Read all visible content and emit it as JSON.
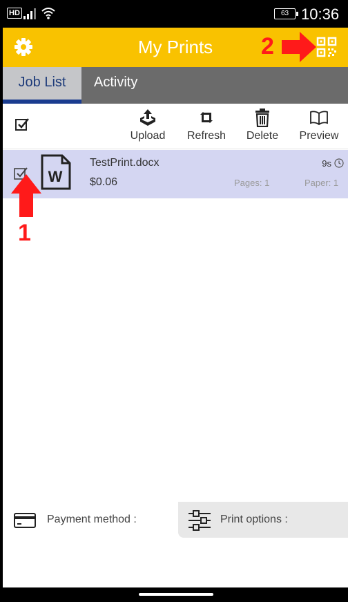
{
  "status_bar": {
    "network": "HD",
    "battery": "63",
    "time": "10:36"
  },
  "header": {
    "title": "My Prints",
    "settings_icon": "gear-icon",
    "scan_icon": "qr-code-icon",
    "brand_color": "#f9c200"
  },
  "annotations": {
    "marker_1": "1",
    "marker_2": "2",
    "color": "#ff1a1a"
  },
  "tabs": [
    {
      "label": "Job List",
      "active": true
    },
    {
      "label": "Activity",
      "active": false
    }
  ],
  "toolbar": {
    "upload": "Upload",
    "refresh": "Refresh",
    "delete": "Delete",
    "preview": "Preview"
  },
  "jobs": [
    {
      "name": "TestPrint.docx",
      "price": "$0.06",
      "time": "9s",
      "pages": "Pages: 1",
      "paper": "Paper: 1",
      "selected": true,
      "file_icon": "word-document-icon"
    }
  ],
  "bottom": {
    "payment_label": "Payment method :",
    "options_label": "Print options :"
  }
}
